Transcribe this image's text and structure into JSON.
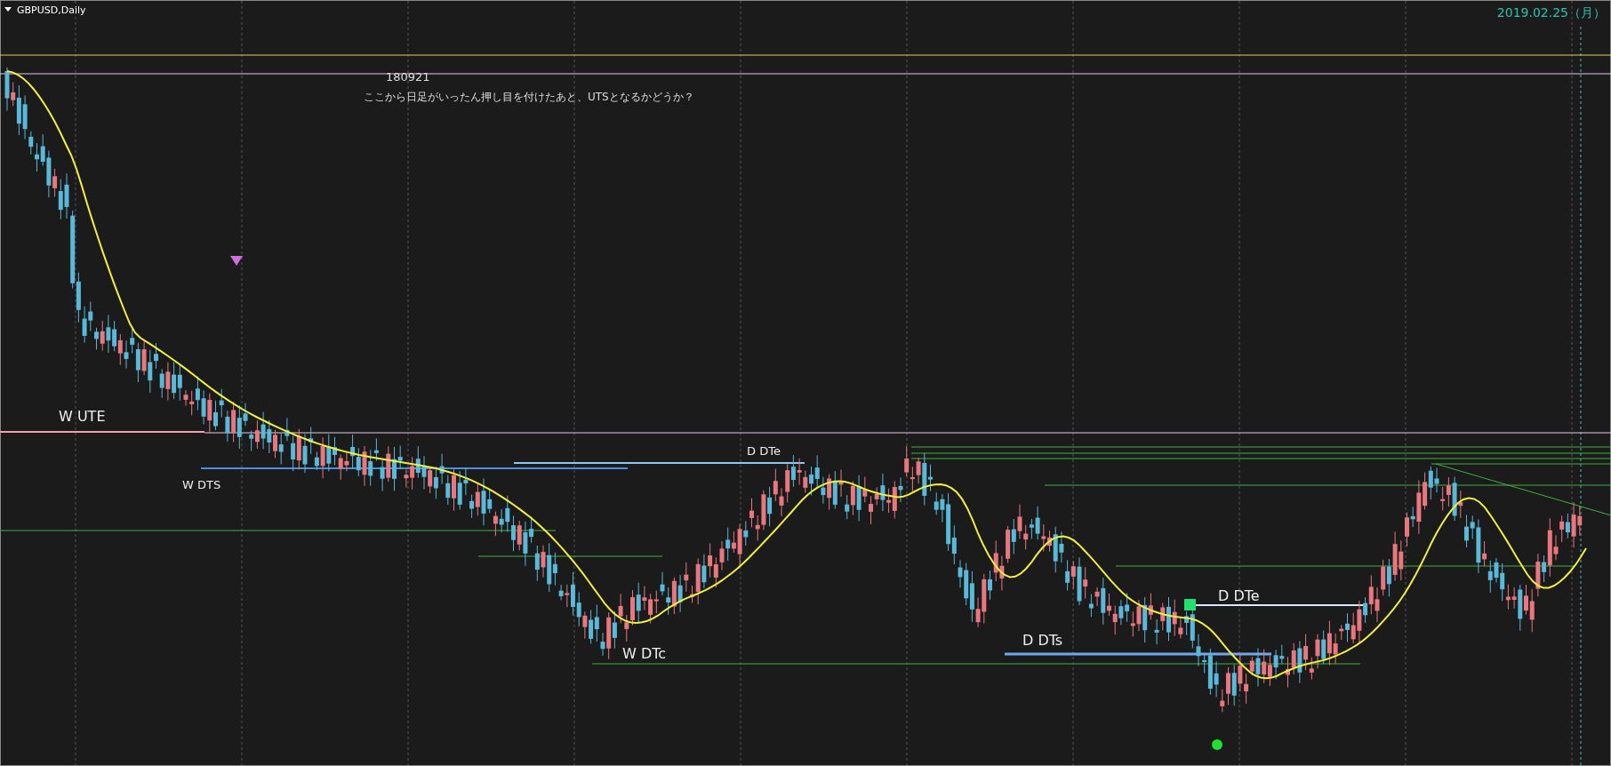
{
  "chart": {
    "title": "GBPUSD,Daily",
    "date": "2019.02.25（月）"
  },
  "note": {
    "date": "180921",
    "comment": "ここから日足がいったん押し目を付けたあと、UTSとなるかどうか？"
  },
  "labels": [
    "W UTE",
    "W DTS",
    "D DTe",
    "W DTc",
    "D DTs",
    "D DTe"
  ]
}
